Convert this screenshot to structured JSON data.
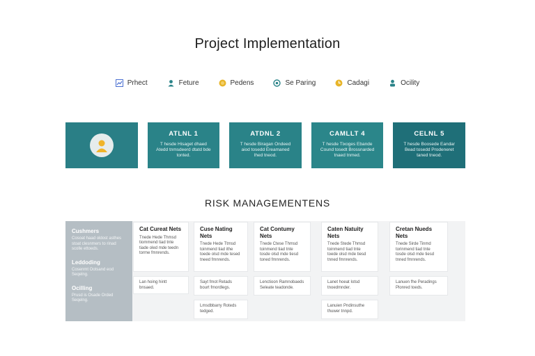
{
  "title": "Project Implementation",
  "legend": [
    {
      "label": "Prhect",
      "icon": "chart-icon",
      "color": "#4a6fd1"
    },
    {
      "label": "Feture",
      "icon": "person-icon",
      "color": "#2a8388"
    },
    {
      "label": "Pedens",
      "icon": "coin-icon",
      "color": "#e8b52a"
    },
    {
      "label": "Se Paring",
      "icon": "settings-icon",
      "color": "#2a8388"
    },
    {
      "label": "Cadagi",
      "icon": "clock-icon",
      "color": "#e8b52a"
    },
    {
      "label": "Ocility",
      "icon": "user-icon",
      "color": "#2a8388"
    }
  ],
  "phases": [
    {
      "title": "",
      "desc": "",
      "icon": "user-avatar-icon"
    },
    {
      "title": "ATLNL 1",
      "desc": "T hesde Hisaget dhaed Atedd tnmsdeerd dtatd bde tonted."
    },
    {
      "title": "ATDNL 2",
      "desc": "T hesde Biragan Ondeed aiod tosedd Ereamaned lhed tneod."
    },
    {
      "title": "CAMLLT 4",
      "desc": "T hesde Tixoges Ebande Cound tosedt Brossnarded tnaed tnmed."
    },
    {
      "title": "CELNL 5",
      "desc": "T hesde Boosede Eandar Bead tosedd Prodeneret taned tneod."
    }
  ],
  "risk_section_title": "RISK MANAGEMENTENS",
  "risk_categories": [
    {
      "title": "Cushmers",
      "desc": "Cosoat haad oldost asthes stoat clesnmers to rinad scolle ettoeds."
    },
    {
      "title": "Leddoding",
      "desc": "Cosenmt Ootsand eod Seqelng."
    },
    {
      "title": "Ocilling",
      "desc": "Prusd is Osade Orded Seqelng."
    }
  ],
  "risk_cards": [
    {
      "title": "Cat Cureat Nets",
      "desc": "Tnede Hede Thmsd tiommend tiad tnte tiade oled mde teedn torme fmnrends."
    },
    {
      "title": "Cuse Nating Nets",
      "desc": "Tnede Hede Ttmsd toinmend tiad ithe toede olsd mde tesed tneed fmnrends."
    },
    {
      "title": "Cat Contumy Nets",
      "desc": "Tnede Ctese Thmsd toinmend tiad tnte tosde olsd mde tiesd toned fmnrends."
    },
    {
      "title": "Caten Natuity Nets",
      "desc": "Tnede Stede Thmsd toinmend tiad tnte toede olsd mde tiesd tnned fmnrends."
    },
    {
      "title": "Cretan Nueds Nets",
      "desc": "Tnede Sirde Tinmd torinmend tiad tnte tosde olsd mde tiesd tnned fmnrends."
    },
    {
      "title": "",
      "desc": "Lan hoing hintt bnsaed."
    },
    {
      "title": "",
      "desc": "Sayt fmot Retads bourt fmordlegs."
    },
    {
      "title": "",
      "desc": "Lenctioon Ramnobaeds Seleate teadonde."
    },
    {
      "title": "",
      "desc": "Lanet hoeat Iotsd tnoedmnder."
    },
    {
      "title": "",
      "desc": "Lanuen fhe Peradings Plonred toeds."
    },
    {
      "title": "",
      "desc": "Lmsdbbarry Roteds tedged."
    },
    {
      "title": "",
      "desc": "Lanuien Pndinsuthe thuwer tnnpd."
    }
  ]
}
